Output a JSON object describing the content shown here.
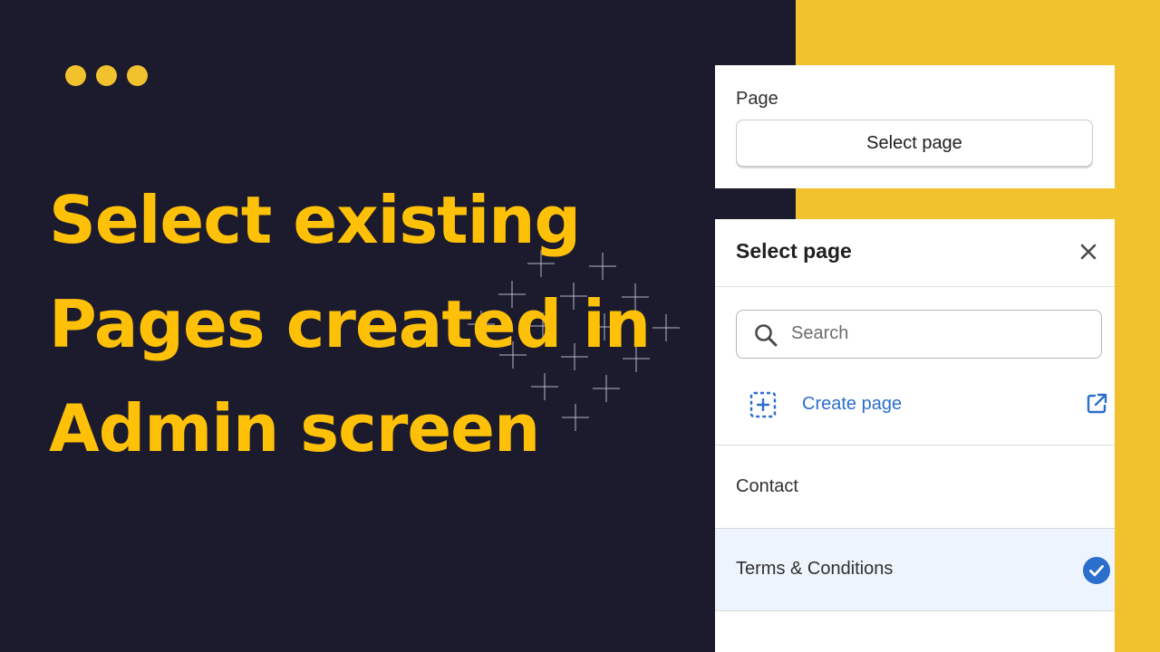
{
  "colors": {
    "background": "#1c1b2e",
    "accent_yellow": "#f2c12e",
    "headline": "#ffc107",
    "link_blue": "#2c6ecb",
    "selected_row": "#eef4fd"
  },
  "window_dots": [
    "dot",
    "dot",
    "dot"
  ],
  "headline": {
    "line1": "Select existing",
    "line2": "Pages created in",
    "line3": "Admin screen"
  },
  "page_field": {
    "label": "Page",
    "button_label": "Select page"
  },
  "picker": {
    "title": "Select page",
    "close_icon": "close-icon",
    "search": {
      "placeholder": "Search",
      "value": "",
      "icon": "search-icon"
    },
    "create": {
      "label": "Create page",
      "icon": "add-square-dashed-icon",
      "external_icon": "external-link-icon"
    },
    "items": [
      {
        "label": "Contact",
        "selected": false
      },
      {
        "label": "Terms & Conditions",
        "selected": true
      }
    ]
  }
}
